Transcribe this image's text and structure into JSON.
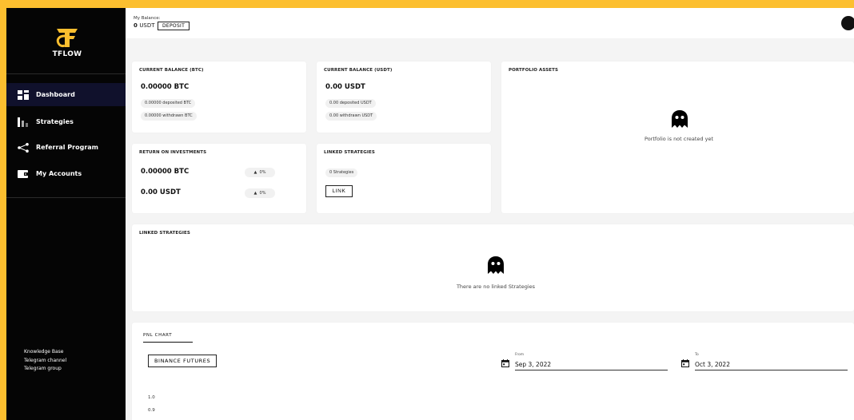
{
  "brand": {
    "name": "TFLOW",
    "accent": "#fcbf2f",
    "sidebar_bg": "#050505",
    "active_bg": "#10112c"
  },
  "sidebar": {
    "nav": [
      {
        "label": "Dashboard",
        "icon": "dashboard-icon",
        "active": true
      },
      {
        "label": "Strategies",
        "icon": "strategies-icon",
        "active": false
      },
      {
        "label": "Referral Program",
        "icon": "share-icon",
        "active": false
      },
      {
        "label": "My Accounts",
        "icon": "wallet-icon",
        "active": false
      }
    ],
    "links": [
      "Knowledge Base",
      "Telegram channel",
      "Telegram group"
    ]
  },
  "topbar": {
    "balance_caption": "My Balance:",
    "balance_amount": "0",
    "balance_unit": "USDT",
    "deposit_label": "DEPOSIT"
  },
  "cards": {
    "btc": {
      "title": "CURRENT BALANCE (BTC)",
      "value": "0.00000 BTC",
      "deposited": "0.00000 deposited BTC",
      "withdrawn": "0.00000 withdrawn BTC"
    },
    "usdt": {
      "title": "CURRENT BALANCE (USDT)",
      "value": "0.00 USDT",
      "deposited": "0.00 deposited USDT",
      "withdrawn": "0.00 withdrawn USDT"
    },
    "portfolio": {
      "title": "PORTFOLIO ASSETS",
      "empty_message": "Portfolio is not created yet"
    },
    "roi": {
      "title": "RETURN ON INVESTMENTS",
      "btc_value": "0.00000 BTC",
      "btc_change": "0%",
      "usdt_value": "0.00 USDT",
      "usdt_change": "0%"
    },
    "linked_small": {
      "title": "LINKED STRATEGIES",
      "count": "0 Strategies",
      "link_label": "LINK"
    },
    "linked_wide": {
      "title": "LINKED STRATEGIES",
      "empty_message": "There are no linked Strategies"
    }
  },
  "pnl": {
    "tab_label": "PNL CHART",
    "exchange_label": "BINANCE FUTURES",
    "from_caption": "From",
    "from_value": "Sep 3, 2022",
    "to_caption": "To",
    "to_value": "Oct 3, 2022",
    "y_ticks": [
      "1.0",
      "0.9"
    ]
  }
}
